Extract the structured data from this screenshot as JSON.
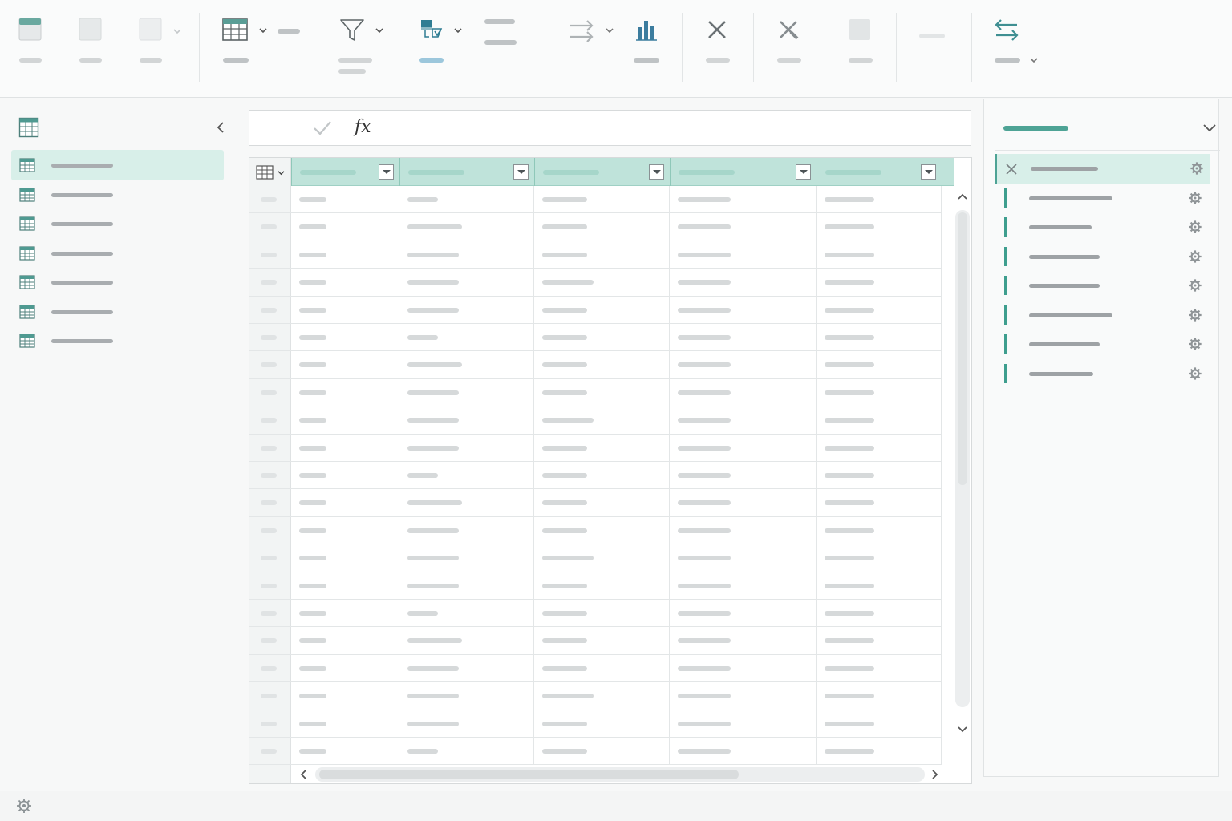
{
  "formula_bar": {
    "fx_label": "fx",
    "value": ""
  },
  "accent_color": "#4ea395",
  "header_color": "#bfe3da",
  "selection_color": "#d8efe9",
  "ribbon": {
    "buttons": [
      {
        "name": "table-view-button",
        "icon": "table-header-icon"
      },
      {
        "name": "blank-button-1",
        "icon": "blank-doc-icon"
      },
      {
        "name": "blank-button-2",
        "icon": "blank-doc-icon"
      },
      {
        "name": "table-button",
        "icon": "table-grid-icon"
      },
      {
        "name": "filter-button",
        "icon": "filter-icon"
      },
      {
        "name": "merge-button",
        "icon": "merge-icon"
      },
      {
        "name": "transform-button",
        "icon": "arrows-right-icon"
      },
      {
        "name": "chart-button",
        "icon": "bar-chart-icon"
      },
      {
        "name": "remove-button",
        "icon": "close-icon"
      },
      {
        "name": "remove-columns-button",
        "icon": "remove-columns-icon"
      },
      {
        "name": "disabled-button",
        "icon": "blank-doc-icon"
      },
      {
        "name": "swap-button",
        "icon": "swap-arrows-icon"
      }
    ]
  },
  "nav": {
    "item_count": 7,
    "selected_index": 0
  },
  "grid": {
    "column_count": 5,
    "row_count": 21
  },
  "steps": {
    "item_count": 8,
    "selected_index": 0
  }
}
